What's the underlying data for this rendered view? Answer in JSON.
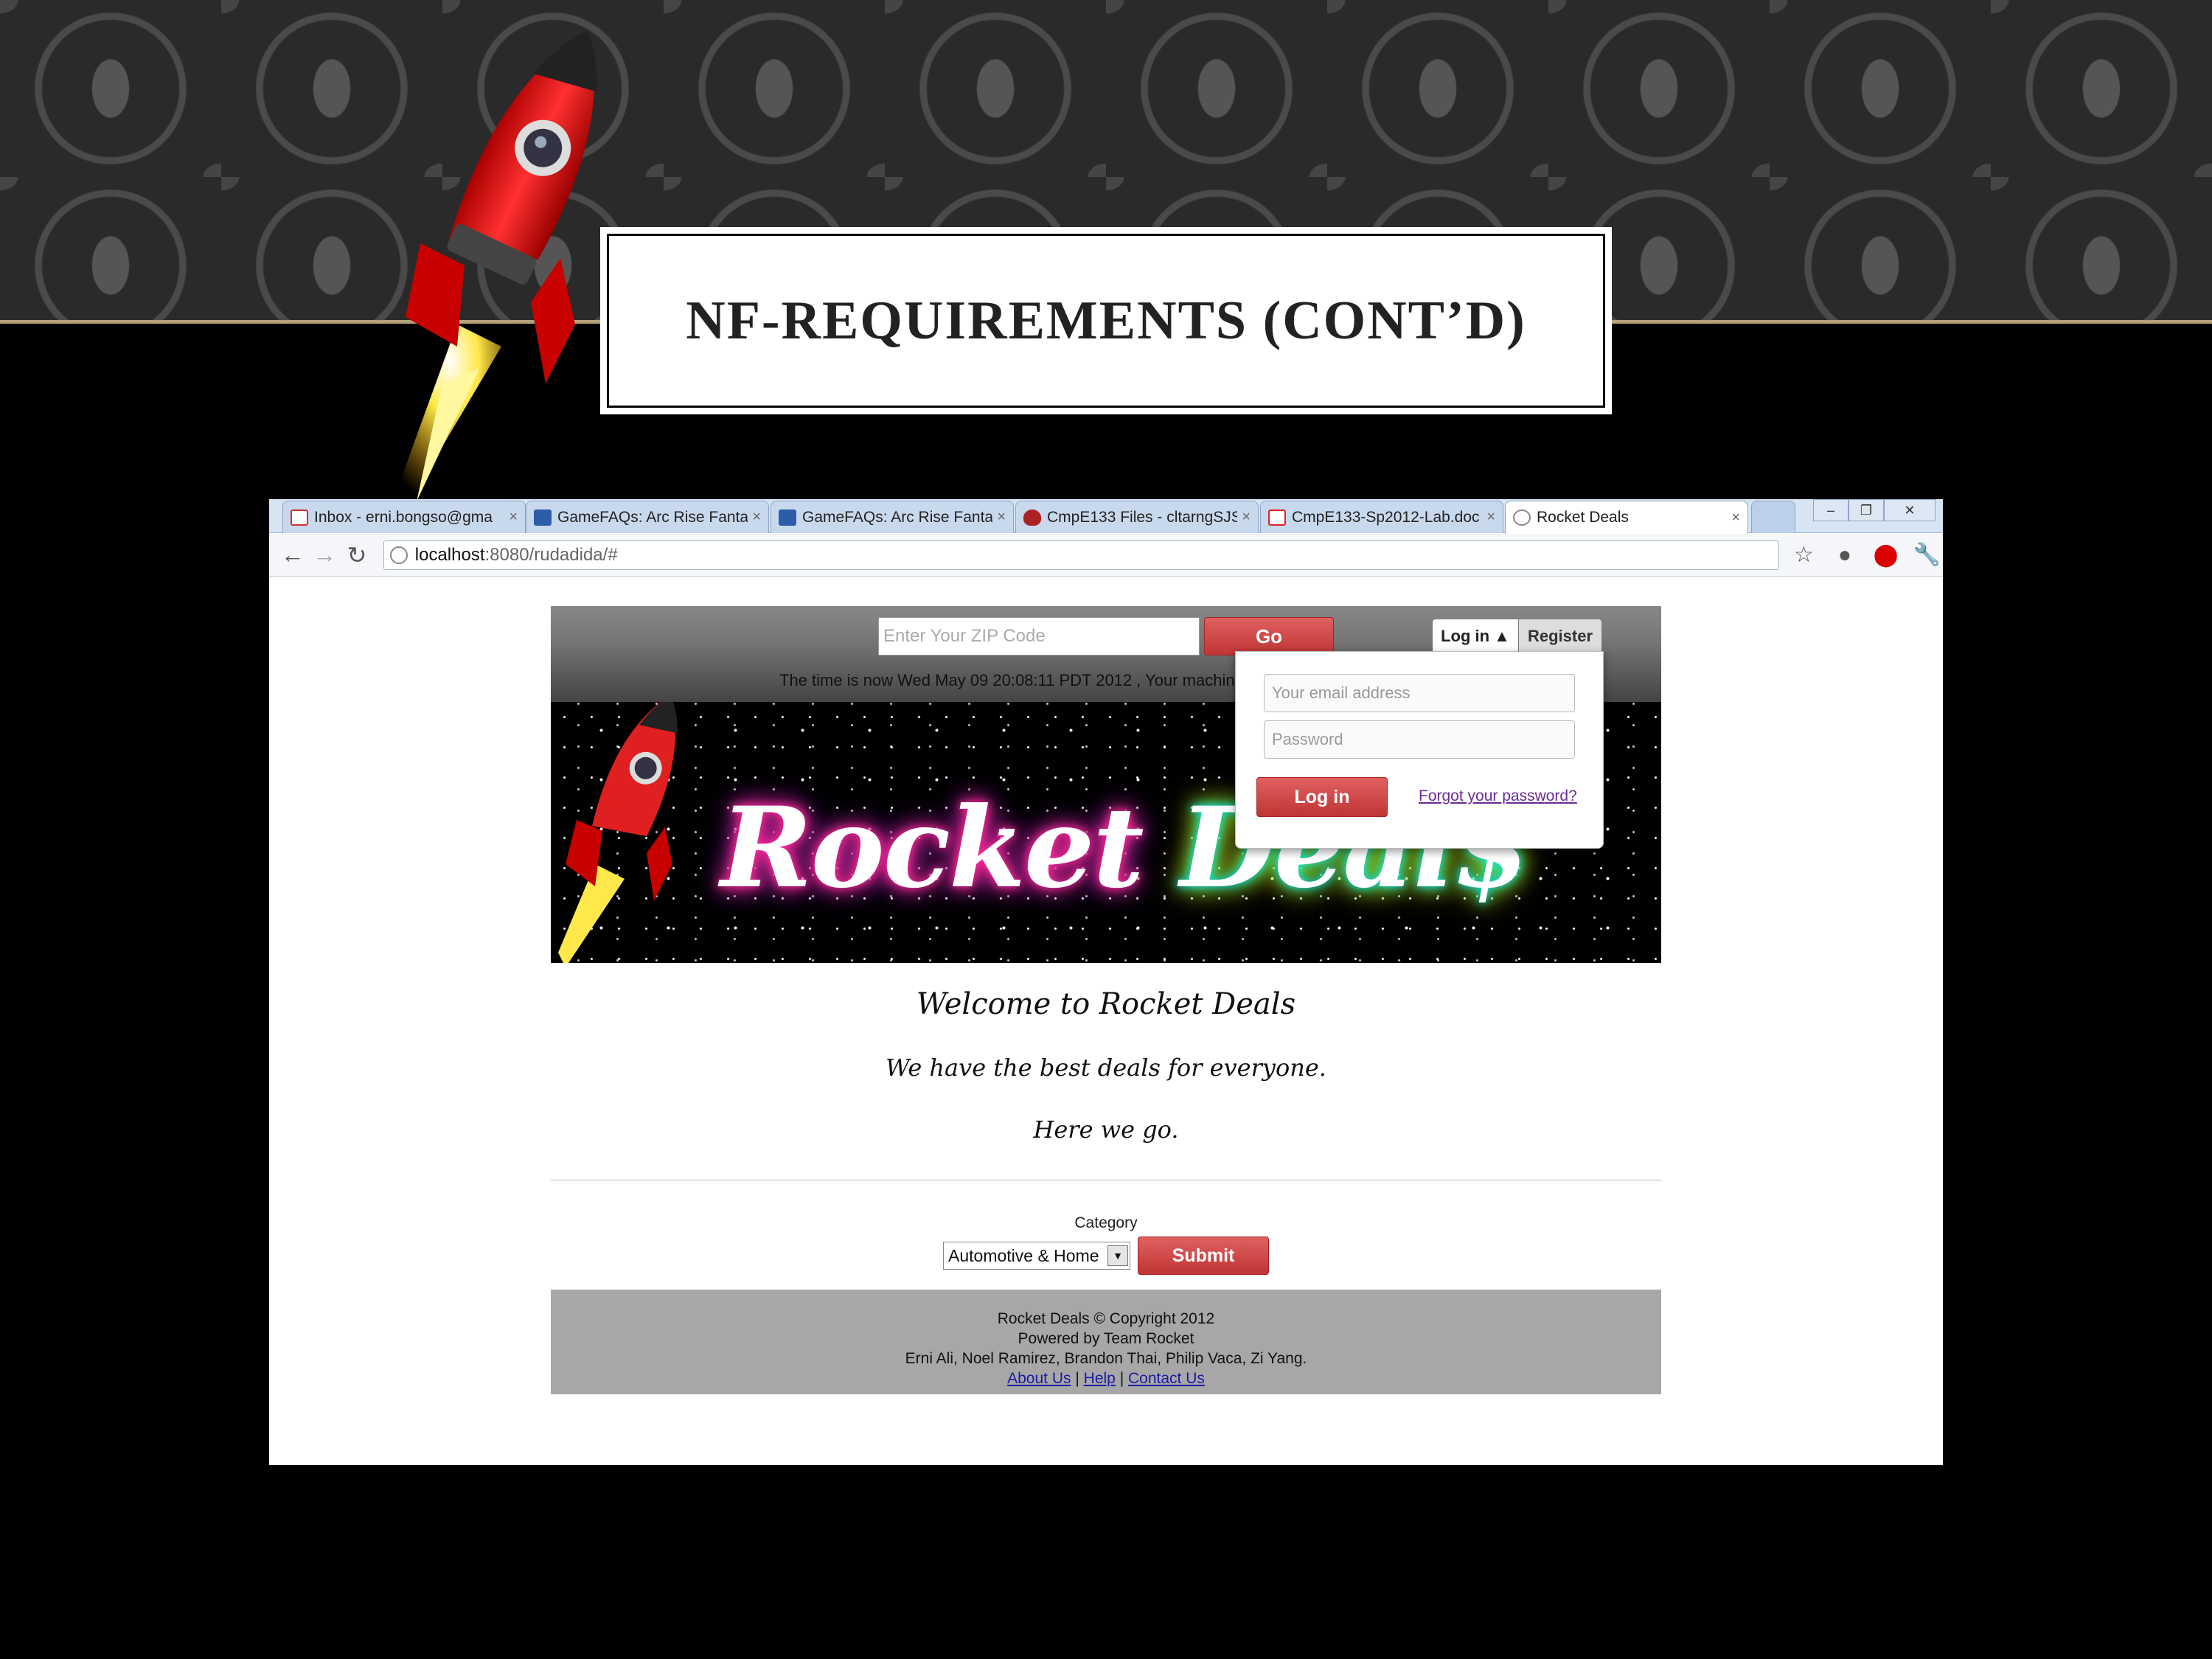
{
  "slide": {
    "title": "NF-REQUIREMENTS (CONT’D)",
    "colors": {
      "background": "#000000",
      "damask": "#2a2a2a",
      "accent_line": "#b5a27a"
    }
  },
  "browser": {
    "tabs": [
      {
        "label": "Inbox - erni.bongso@gma",
        "icon": "gmail-icon",
        "active": false
      },
      {
        "label": "GameFAQs: Arc Rise Fanta",
        "icon": "gamefaqs-icon",
        "active": false
      },
      {
        "label": "GameFAQs: Arc Rise Fanta",
        "icon": "gamefaqs-icon",
        "active": false
      },
      {
        "label": "CmpE133 Files - cltarngSJS",
        "icon": "shield-icon",
        "active": false
      },
      {
        "label": "CmpE133-Sp2012-Lab.doc",
        "icon": "pdf-icon",
        "active": false
      },
      {
        "label": "Rocket Deals",
        "icon": "globe-icon",
        "active": true
      }
    ],
    "close_glyph": "×",
    "window_controls": {
      "minimize": "–",
      "maximize": "❐",
      "close": "✕"
    },
    "url_host": "localhost",
    "url_rest": ":8080/rudadida/#"
  },
  "site": {
    "zip_placeholder": "Enter Your ZIP Code",
    "go_label": "Go",
    "login_tab": "Log in ▲",
    "register_tab": "Register",
    "time_text": "The time is now Wed May 09 20:08:11 PDT 2012 , Your machine",
    "banner_word1": "Rocket",
    "banner_word2": "Deal$",
    "login_panel": {
      "email_placeholder": "Your email address",
      "password_placeholder": "Password",
      "login_button": "Log in",
      "forgot_link": "Forgot your password?"
    },
    "welcome_title": "Welcome to Rocket Deals",
    "welcome_sub": "We have the best deals for everyone.",
    "welcome_go": "Here we go.",
    "category_label": "Category",
    "category_selected": "Automotive & Home",
    "submit_label": "Submit",
    "footer": {
      "line1": "Rocket Deals © Copyright 2012",
      "line2": "Powered by Team Rocket",
      "line3": "Erni Ali, Noel Ramirez, Brandon Thai, Philip Vaca, Zi Yang.",
      "about": "About Us",
      "help": "Help",
      "contact": "Contact Us",
      "sep": "|"
    },
    "colors": {
      "button_red": "#c03535",
      "footer_gray": "#a7a7a7",
      "link_blue": "#1a1aa6"
    }
  }
}
